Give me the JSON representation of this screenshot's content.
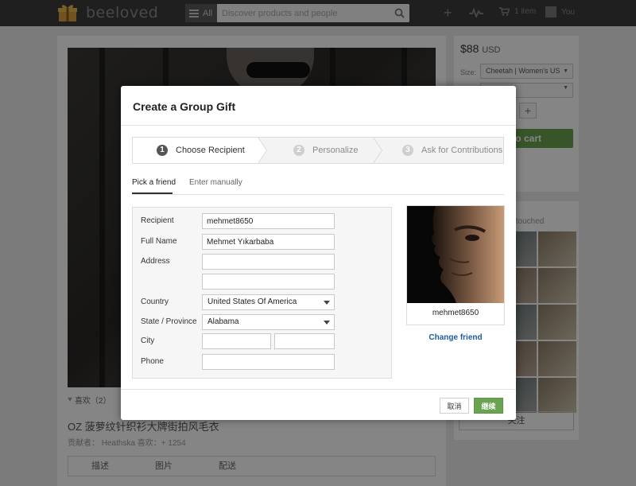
{
  "header": {
    "logo_text": "beeloved",
    "search_category": "All",
    "search_placeholder": "Discover products and people",
    "cart_label": "1 item",
    "user_label": "You"
  },
  "background": {
    "like_text": "喜欢（2）",
    "product_title": "OZ 菠萝纹针织衫大牌街拍风毛衣",
    "product_meta": "贡献者： Heathska    喜欢：+ 1254",
    "tabs": [
      "描述",
      "图片",
      "配送"
    ],
    "price": "$88",
    "currency": "USD",
    "size_label": "Size:",
    "size_value": "Cheetah | Women's US",
    "qty_plus": "+",
    "cart_button": "to cart",
    "following_label": "s touched",
    "follow_button": "关注"
  },
  "modal": {
    "title": "Create a Group Gift",
    "steps": [
      {
        "num": "1",
        "label": "Choose Recipient"
      },
      {
        "num": "2",
        "label": "Personalize"
      },
      {
        "num": "3",
        "label": "Ask for Contributions"
      }
    ],
    "subtabs": [
      "Pick a friend",
      "Enter manually"
    ],
    "form": {
      "recipient_label": "Recipient",
      "recipient_value": "mehmet8650",
      "fullname_label": "Full Name",
      "fullname_value": "Mehmet Yıkarbaba",
      "address_label": "Address",
      "address1_value": "",
      "address2_value": "",
      "country_label": "Country",
      "country_value": "United States Of America",
      "state_label": "State / Province",
      "state_value": "Alabama",
      "city_label": "City",
      "city_value": "",
      "zip_value": "",
      "phone_label": "Phone",
      "phone_value": ""
    },
    "friend": {
      "name": "mehmet8650",
      "change_label": "Change friend"
    },
    "buttons": {
      "cancel": "取消",
      "continue": "继续"
    }
  },
  "colors": {
    "topbar": "#3c3c3c",
    "accent_green": "#6aa352",
    "link_blue": "#1c5aa6"
  }
}
